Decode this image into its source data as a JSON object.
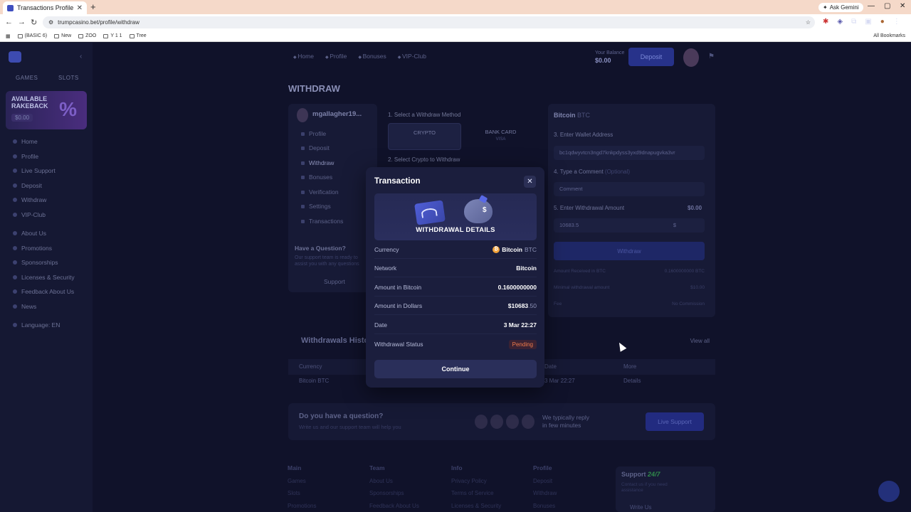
{
  "browser": {
    "tab_title": "Transactions Profile",
    "url": "trumpcasino.bet/profile/withdraw",
    "ask_gemini": "Ask Gemini",
    "all_bookmarks": "All Bookmarks",
    "bookmarks": [
      "(BASIC 6)",
      "New",
      "ZOO",
      "Y 1 1",
      "Tree"
    ]
  },
  "leftnav": {
    "tabs": [
      "GAMES",
      "SLOTS"
    ],
    "rakeback_title": "AVAILABLE RAKEBACK",
    "rakeback_value": "$0.00",
    "menu1": [
      "Home",
      "Profile",
      "Live Support",
      "Deposit",
      "Withdraw",
      "VIP-Club"
    ],
    "menu2": [
      "About Us",
      "Promotions",
      "Sponsorships",
      "Licenses & Security",
      "Feedback About Us",
      "News"
    ],
    "language": "Language: EN"
  },
  "topnav": {
    "links": [
      "Home",
      "Profile",
      "Bonuses",
      "VIP-Club"
    ],
    "wallet_label": "Your Balance",
    "wallet_value": "$0.00",
    "deposit": "Deposit"
  },
  "page_title": "WITHDRAW",
  "profile_card": {
    "username": "mgallagher19...",
    "menu": [
      "Profile",
      "Deposit",
      "Withdraw",
      "Bonuses",
      "Verification",
      "Settings",
      "Transactions"
    ],
    "question_title": "Have a Question?",
    "question_text": "Our support team is ready to assist you with any questions",
    "support": "Support"
  },
  "steps": {
    "s1": "1. Select a Withdraw Method",
    "crypto": "CRYPTO",
    "bank": "BANK CARD",
    "visa": "VISA",
    "s2": "2. Select Crypto to Withdraw"
  },
  "wform": {
    "coin": "Bitcoin",
    "coin_sub": "BTC",
    "s3": "3. Enter Wallet Address",
    "address": "bc1qdwyvtcn3ngd7knkpdyss3yxd9dnapugvka3vr",
    "s4": "4. Type a Comment",
    "s4_opt": "(Optional)",
    "comment_ph": "Comment",
    "s5": "5. Enter Withdrawal Amount",
    "bal": "$0.00",
    "amount": "10683.5",
    "currency": "$",
    "withdraw": "Withdraw",
    "info1_l": "Amount Received in BTC",
    "info1_v": "0.1600000000 BTC",
    "info2_l": "Minimal withdrawal amount",
    "info2_v": "$10.00",
    "info3_l": "Fee",
    "info3_v": "No Commission"
  },
  "history": {
    "title": "Withdrawals History",
    "view_all": "View all",
    "cols": [
      "Currency",
      "Date",
      "More"
    ],
    "row": [
      "Bitcoin BTC",
      "3 Mar 22:27",
      "Details"
    ]
  },
  "question_bar": {
    "title": "Do you have a question?",
    "sub": "Write us and our support team will help you",
    "reply": "We typically reply",
    "reply2": "in few minutes",
    "btn": "Live Support"
  },
  "footer": {
    "cols": [
      {
        "head": "Main",
        "items": [
          "Games",
          "Slots",
          "Promotions"
        ]
      },
      {
        "head": "Team",
        "items": [
          "About Us",
          "Sponsorships",
          "Feedback About Us"
        ]
      },
      {
        "head": "Info",
        "items": [
          "Privacy Policy",
          "Terms of Service",
          "Licenses & Security"
        ]
      },
      {
        "head": "Profile",
        "items": [
          "Deposit",
          "Withdraw",
          "Bonuses"
        ]
      }
    ],
    "support_title": "Support",
    "support_247": "24/7",
    "support_text": "Contact us if you need assistance",
    "write_us": "Write Us"
  },
  "modal": {
    "title": "Transaction",
    "banner_text": "WITHDRAWAL DETAILS",
    "rows": [
      {
        "label": "Currency",
        "value": "Bitcoin",
        "sub": "BTC"
      },
      {
        "label": "Network",
        "value": "Bitcoin"
      },
      {
        "label": "Amount in Bitcoin",
        "value": "0.1600000000"
      },
      {
        "label": "Amount in Dollars",
        "value": "$10683",
        "sub": ".50"
      },
      {
        "label": "Date",
        "value": "3 Mar 22:27"
      },
      {
        "label": "Withdrawal Status",
        "value": "Pending"
      }
    ],
    "continue": "Continue",
    "status_color": "#f07b4a"
  }
}
